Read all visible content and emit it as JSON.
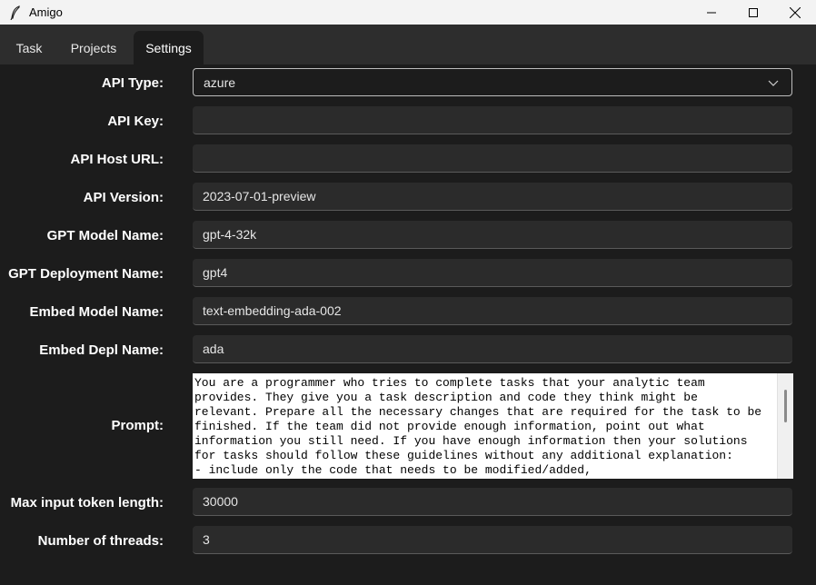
{
  "window": {
    "title": "Amigo",
    "app_icon": "feather-icon",
    "controls": [
      "minimize-icon",
      "maximize-icon",
      "close-icon"
    ]
  },
  "tabs": [
    {
      "label": "Task",
      "active": false
    },
    {
      "label": "Projects",
      "active": false
    },
    {
      "label": "Settings",
      "active": true
    }
  ],
  "settings": {
    "api_type": {
      "label": "API Type:",
      "value": "azure",
      "icon": "chevron-down-icon"
    },
    "api_key": {
      "label": "API Key:",
      "value": ""
    },
    "api_host_url": {
      "label": "API Host URL:",
      "value": ""
    },
    "api_version": {
      "label": "API Version:",
      "value": "2023-07-01-preview"
    },
    "gpt_model_name": {
      "label": "GPT Model Name:",
      "value": "gpt-4-32k"
    },
    "gpt_deployment_name": {
      "label": "GPT Deployment Name:",
      "value": "gpt4"
    },
    "embed_model_name": {
      "label": "Embed Model Name:",
      "value": "text-embedding-ada-002"
    },
    "embed_depl_name": {
      "label": "Embed Depl Name:",
      "value": "ada"
    },
    "prompt": {
      "label": "Prompt:",
      "value": "You are a programmer who tries to complete tasks that your analytic team\nprovides. They give you a task description and code they think might be\nrelevant. Prepare all the necessary changes that are required for the task to be\nfinished. If the team did not provide enough information, point out what\ninformation you still need. If you have enough information then your solutions\nfor tasks should follow these guidelines without any additional explanation:\n- include only the code that needs to be modified/added,"
    },
    "max_input_token_length": {
      "label": "Max input token length:",
      "value": "30000"
    },
    "number_of_threads": {
      "label": "Number of threads:",
      "value": "3"
    }
  },
  "colors": {
    "background": "#1c1c1c",
    "tabbar": "#2d2d2d",
    "field": "#2b2b2b",
    "titlebar": "#f3f3f3"
  }
}
